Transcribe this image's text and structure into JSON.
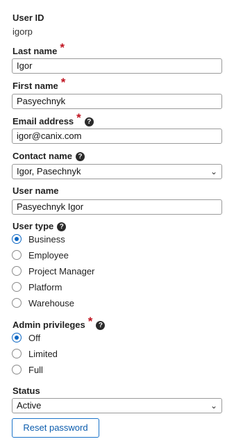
{
  "user_id": {
    "label": "User ID",
    "value": "igorp"
  },
  "last_name": {
    "label": "Last name",
    "required_mark": "*",
    "value": "Igor"
  },
  "first_name": {
    "label": "First name",
    "required_mark": "*",
    "value": "Pasyechnyk"
  },
  "email": {
    "label": "Email address",
    "required_mark": "*",
    "help": "?",
    "value": "igor@canix.com"
  },
  "contact_name": {
    "label": "Contact name",
    "help": "?",
    "value": "Igor, Pasechnyk",
    "chevron": "⌄"
  },
  "user_name": {
    "label": "User name",
    "value": "Pasyechnyk Igor"
  },
  "user_type": {
    "label": "User type",
    "help": "?",
    "options": [
      "Business",
      "Employee",
      "Project Manager",
      "Platform",
      "Warehouse"
    ],
    "selected": "Business"
  },
  "admin_privileges": {
    "label": "Admin privileges",
    "required_mark": "*",
    "help": "?",
    "options": [
      "Off",
      "Limited",
      "Full"
    ],
    "selected": "Off"
  },
  "status": {
    "label": "Status",
    "value": "Active",
    "chevron": "⌄"
  },
  "reset_button": {
    "label": "Reset password"
  },
  "colors": {
    "accent": "#0b66c3",
    "required": "#c0131f"
  },
  "icons": {
    "help": "help-circle-icon",
    "chevron": "chevron-down-icon"
  }
}
